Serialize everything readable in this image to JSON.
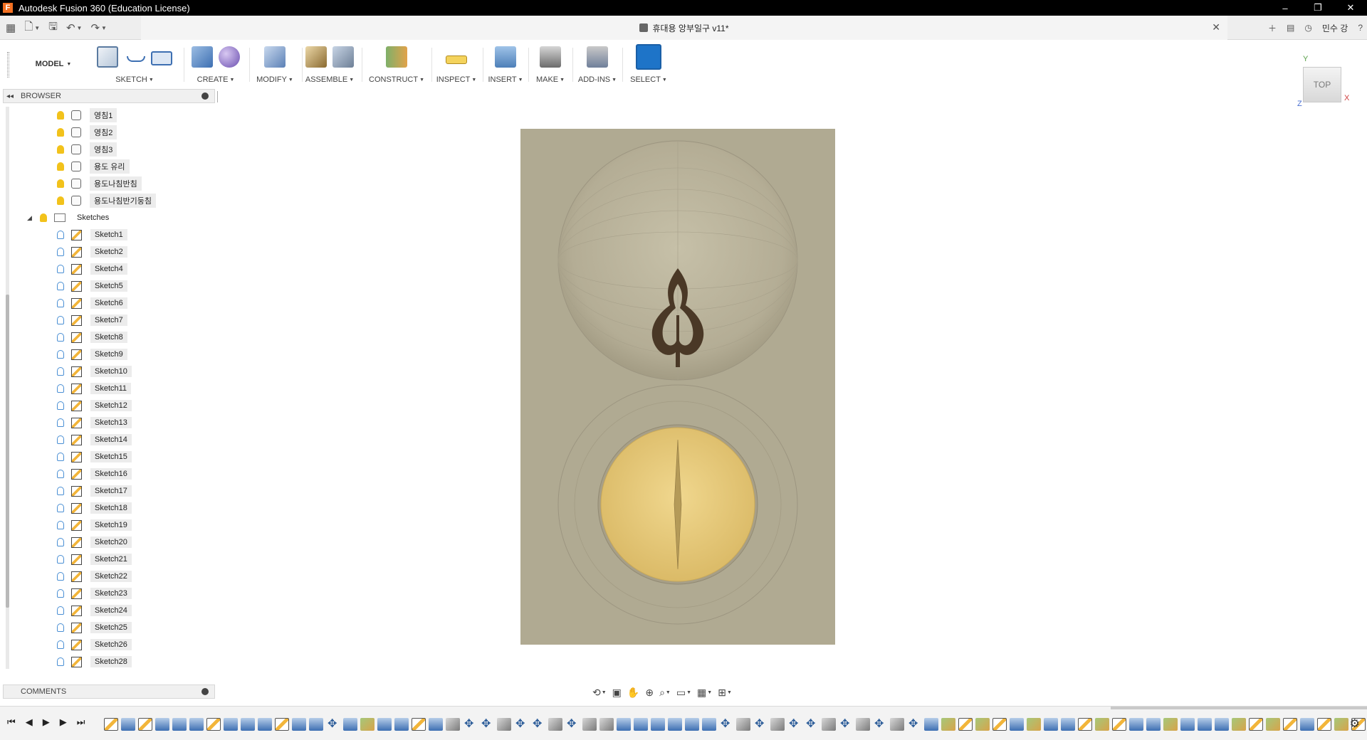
{
  "window": {
    "title": "Autodesk Fusion 360 (Education License)",
    "logo_letter": "F",
    "controls": [
      "–",
      "❐",
      "✕"
    ]
  },
  "qat": {
    "doc_name": "휴대용 앙부일구 v11*",
    "close_glyph": "✕",
    "user": "민수 강",
    "icons": [
      "grid-icon",
      "file-icon",
      "save-icon",
      "undo-icon",
      "redo-icon"
    ],
    "right_icons": [
      "plus-icon",
      "notifications-icon",
      "history-icon",
      "help-icon"
    ],
    "glyphs": {
      "grid": "▦",
      "file": "🗋",
      "save": "🖫",
      "undo": "↶",
      "redo": "↷",
      "plus": "＋",
      "notifications": "▤",
      "history": "◷",
      "help": "?"
    }
  },
  "ribbon": {
    "workspace": "MODEL",
    "groups": {
      "sketch": "SKETCH",
      "create": "CREATE",
      "modify": "MODIFY",
      "assemble": "ASSEMBLE",
      "construct": "CONSTRUCT",
      "inspect": "INSPECT",
      "insert": "INSERT",
      "make": "MAKE",
      "addins": "ADD-INS",
      "select": "SELECT"
    }
  },
  "viewcube": {
    "face": "TOP",
    "axis_y": "Y",
    "axis_x": "X",
    "axis_z": "Z"
  },
  "browser": {
    "title": "BROWSER",
    "collapse_glyph": "◂◂",
    "bodies": [
      "영침1",
      "영침2",
      "영침3",
      "용도 유리",
      "용도나침반침",
      "용도나침반기둥침"
    ],
    "folder": "Sketches",
    "folder_expander": "◢",
    "sketches": [
      "Sketch1",
      "Sketch2",
      "Sketch4",
      "Sketch5",
      "Sketch6",
      "Sketch7",
      "Sketch8",
      "Sketch9",
      "Sketch10",
      "Sketch11",
      "Sketch12",
      "Sketch13",
      "Sketch14",
      "Sketch15",
      "Sketch16",
      "Sketch17",
      "Sketch18",
      "Sketch19",
      "Sketch20",
      "Sketch21",
      "Sketch22",
      "Sketch23",
      "Sketch24",
      "Sketch25",
      "Sketch26",
      "Sketch28"
    ]
  },
  "comments": {
    "title": "COMMENTS"
  },
  "navbar": {
    "icons": [
      "orbit-icon",
      "look-at-icon",
      "pan-icon",
      "zoom-icon",
      "zoom-window-icon",
      "display-settings-icon",
      "grid-settings-icon",
      "viewports-icon"
    ],
    "glyphs": [
      "⟲",
      "▣",
      "✋",
      "⊕",
      "⌕",
      "▭",
      "▦",
      "⊞"
    ]
  },
  "timeline": {
    "controls": [
      "⏮",
      "◀",
      "▶",
      "▶",
      "⏭"
    ],
    "features": [
      "sk",
      "ex",
      "sk",
      "ex",
      "ex",
      "ex",
      "sk",
      "ex",
      "ex",
      "ex",
      "sk",
      "ex",
      "ex",
      "mv",
      "ex",
      "rv",
      "ex",
      "ex",
      "sk",
      "ex",
      "jt",
      "mv",
      "mv",
      "jt",
      "mv",
      "mv",
      "jt",
      "mv",
      "jt",
      "jt",
      "ex",
      "ex",
      "ex",
      "ex",
      "ex",
      "ex",
      "mv",
      "jt",
      "mv",
      "jt",
      "mv",
      "mv",
      "jt",
      "mv",
      "jt",
      "mv",
      "jt",
      "mv",
      "ex",
      "rv",
      "sk",
      "rv",
      "sk",
      "ex",
      "rv",
      "ex",
      "ex",
      "sk",
      "rv",
      "sk",
      "ex",
      "ex",
      "rv",
      "ex",
      "ex",
      "ex",
      "rv",
      "sk",
      "rv",
      "sk",
      "ex",
      "sk",
      "rv",
      "sk"
    ],
    "settings_glyph": "⚙"
  },
  "colors": {
    "viewport_plate": "#b0aa92",
    "dial_gold": "#e3c77a",
    "gnomon_dark": "#4a3826",
    "selection_blue": "#1e74c8"
  }
}
